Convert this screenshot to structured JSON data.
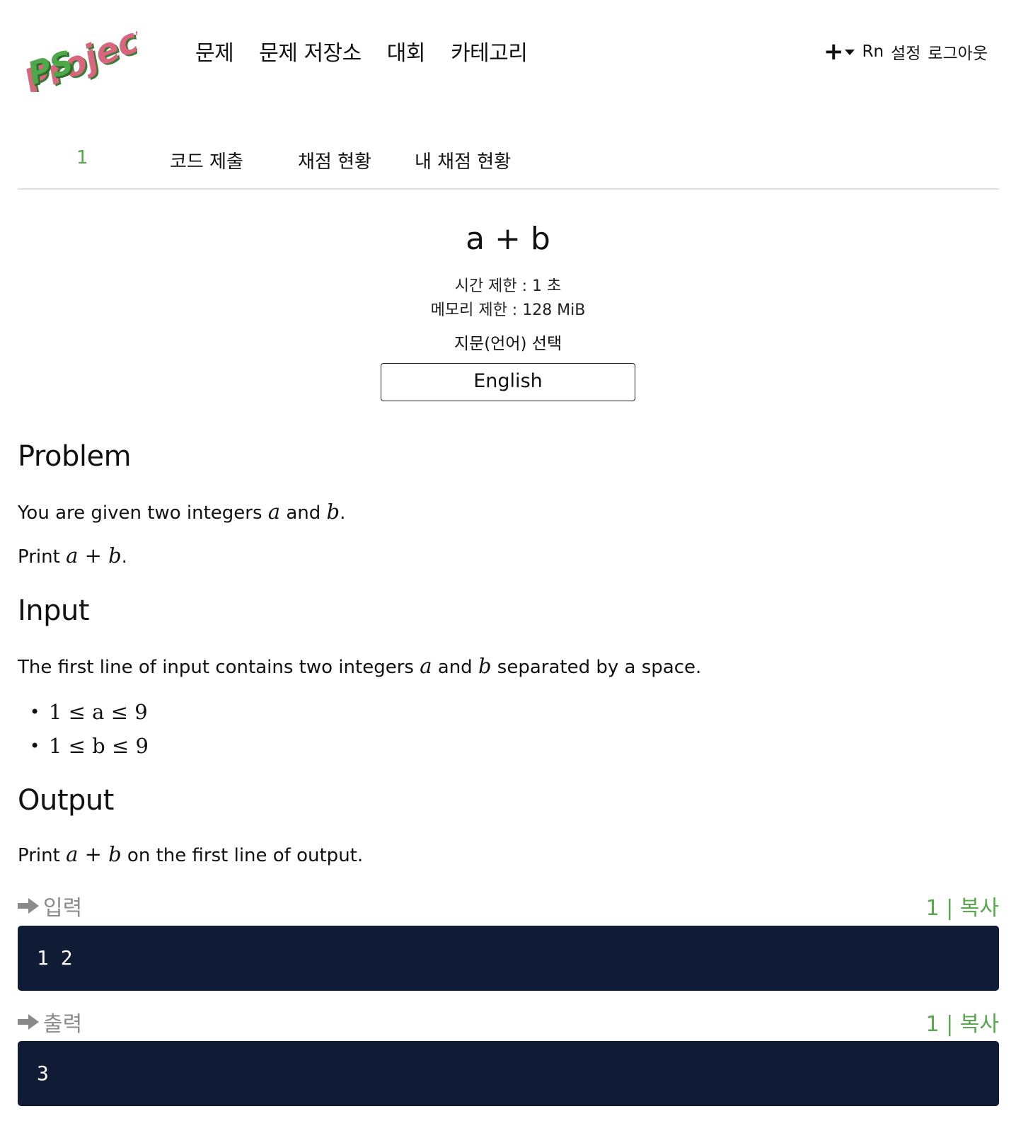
{
  "header": {
    "logo_text": [
      "Project",
      "PS"
    ],
    "nav": [
      "문제",
      "문제 저장소",
      "대회",
      "카테고리"
    ],
    "plus_symbol": "+",
    "user": {
      "name": "Rn",
      "settings": "설정",
      "logout": "로그아웃"
    }
  },
  "tabs": [
    "1",
    "코드 제출",
    "채점 현황",
    "내 채점 현황"
  ],
  "problem": {
    "title": "a + b",
    "time_limit": "시간 제한 : 1 초",
    "memory_limit": "메모리 제한 : 128 MiB",
    "language_label": "지문(언어) 선택",
    "language_value": "English"
  },
  "sections": {
    "problem": {
      "heading": "Problem",
      "line1": {
        "pre": "You are given two integers ",
        "a": "a",
        "mid": " and ",
        "b": "b",
        "post": "."
      },
      "line2": {
        "pre": "Print ",
        "expr": "a + b",
        "post": "."
      }
    },
    "input": {
      "heading": "Input",
      "line": {
        "pre": "The first line of input contains two integers ",
        "a": "a",
        "mid": " and ",
        "b": "b",
        "post": " separated by a space."
      },
      "constraints": [
        "1 ≤ a ≤ 9",
        "1 ≤ b ≤ 9"
      ]
    },
    "output": {
      "heading": "Output",
      "line": {
        "pre": "Print ",
        "expr": "a + b",
        "post": " on the first line of output."
      }
    }
  },
  "samples": {
    "input": {
      "label": "입력",
      "actions": "1 | 복사",
      "content": "1 2"
    },
    "output": {
      "label": "출력",
      "actions": "1 | 복사",
      "content": "3"
    }
  },
  "colors": {
    "accent": "#58a84d",
    "code_bg": "#101c36",
    "logo_green": "#4fa84a",
    "logo_pink": "#d9667e"
  }
}
